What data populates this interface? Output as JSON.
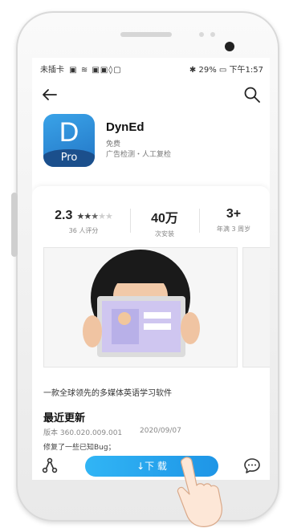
{
  "status_bar": {
    "carrier": "未插卡",
    "battery": "29%",
    "time": "下午1:57"
  },
  "app": {
    "name": "DynEd",
    "icon_letter": "D",
    "icon_badge": "Pro",
    "price": "免费",
    "check_note": "广告检测・人工复检"
  },
  "stats": {
    "rating": "2.3",
    "rating_stars": 2.5,
    "rating_count": "36 人评分",
    "installs": "40万",
    "installs_label": "次安装",
    "age": "3+",
    "age_label": "年满 3 周岁"
  },
  "description": "一款全球领先的多媒体英语学习软件",
  "update": {
    "title": "最近更新",
    "version": "版本 360.020.009.001",
    "date": "2020/09/07",
    "notes": "修复了一些已知Bug；"
  },
  "actions": {
    "download_label": "↓下 载"
  },
  "icons": [
    "back-arrow-icon",
    "search-icon",
    "share-icon",
    "comment-icon"
  ],
  "colors": {
    "accent": "#1e95e6",
    "icon_bg": "#2b86d6",
    "icon_badge_bg": "#1b4f8c"
  }
}
